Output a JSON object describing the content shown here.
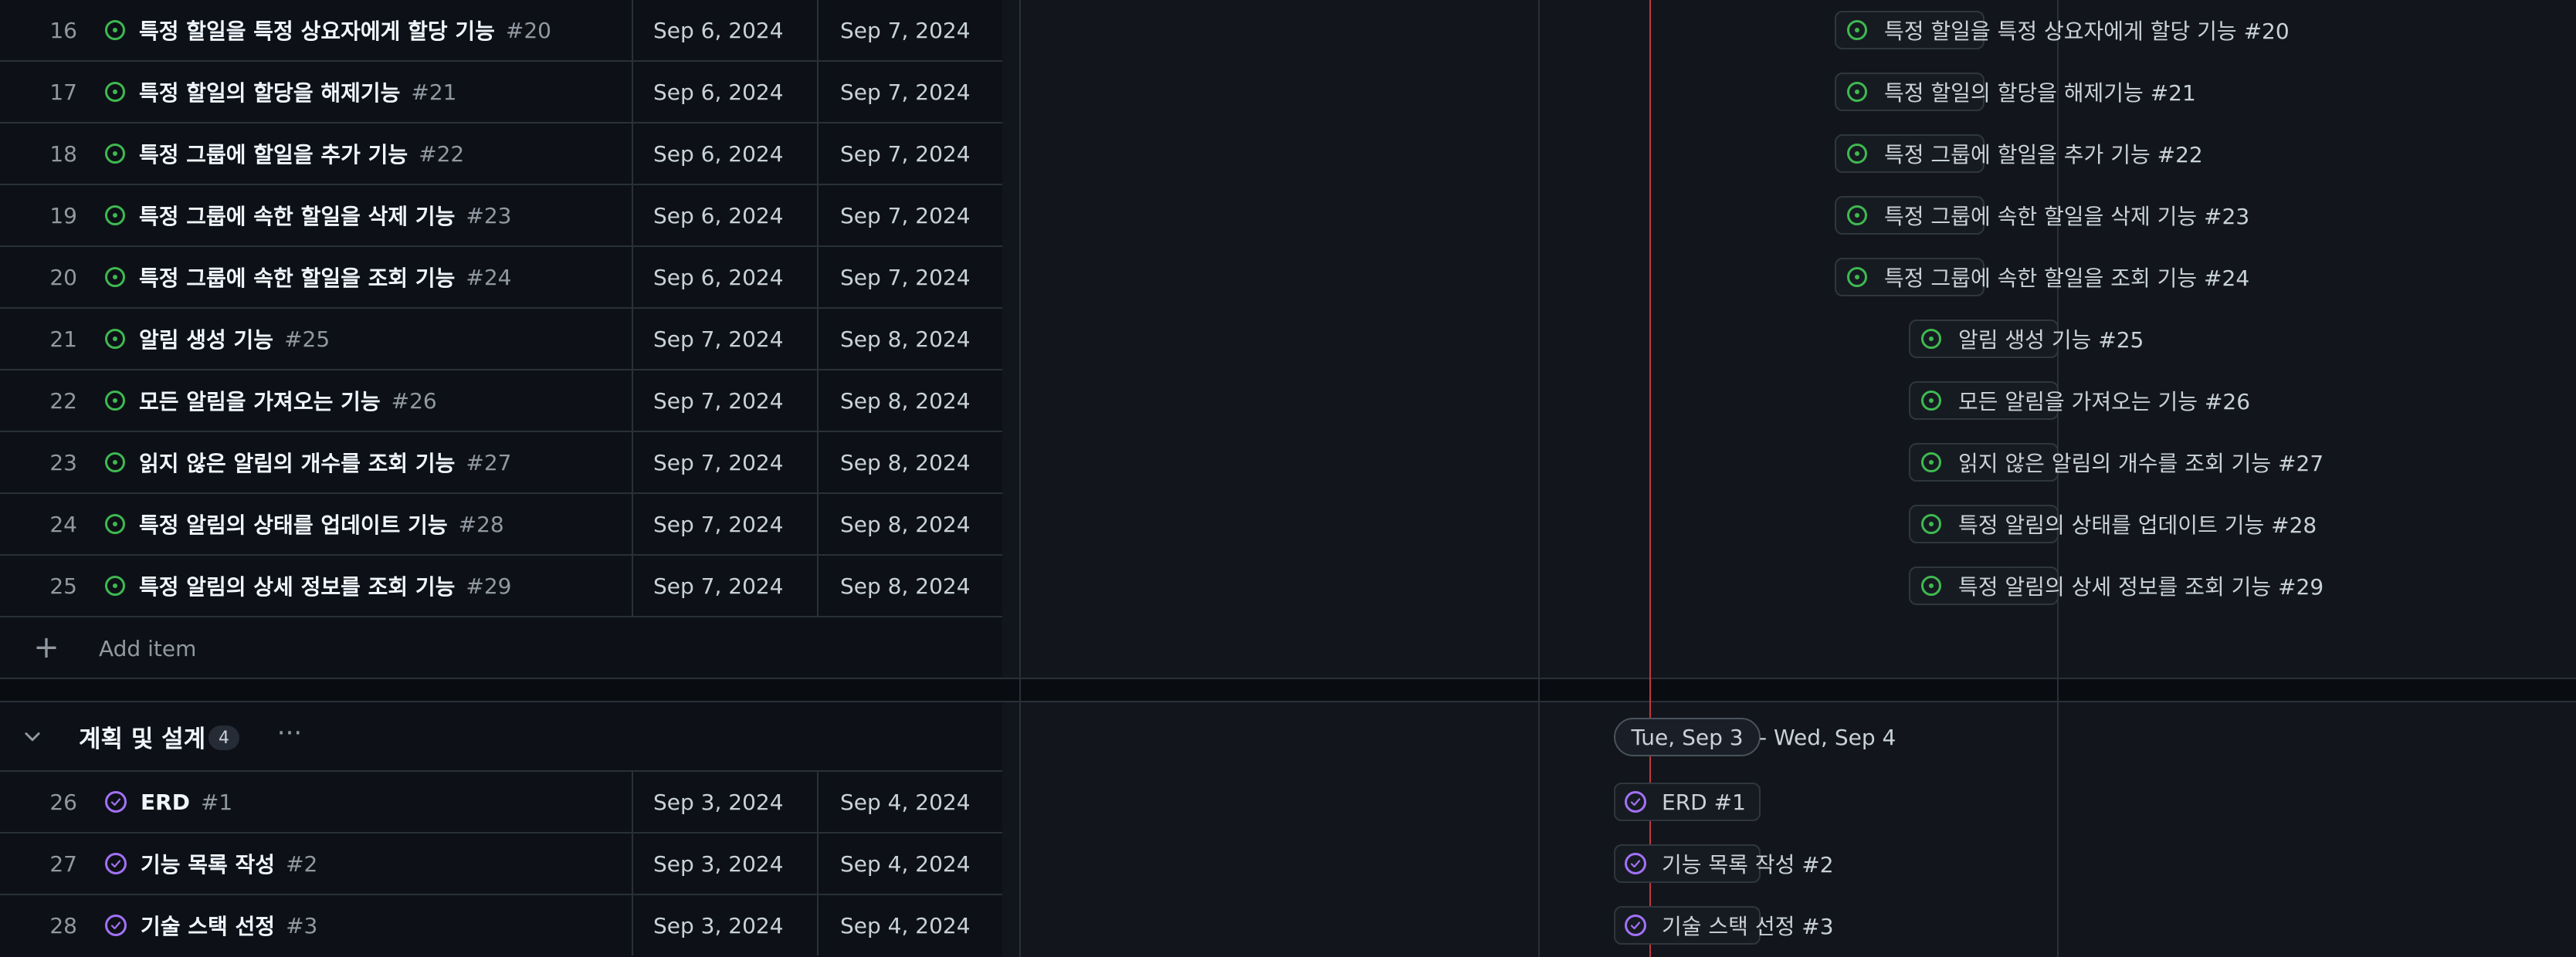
{
  "table": {
    "rows": [
      {
        "num": "16",
        "title": "특정 할일을 특정 상요자에게 할당 기능",
        "issue": "#20",
        "start": "Sep 6, 2024",
        "end": "Sep 7, 2024",
        "status": "open"
      },
      {
        "num": "17",
        "title": "특정 할일의 할당을 해제기능",
        "issue": "#21",
        "start": "Sep 6, 2024",
        "end": "Sep 7, 2024",
        "status": "open"
      },
      {
        "num": "18",
        "title": "특정 그룹에 할일을 추가 기능",
        "issue": "#22",
        "start": "Sep 6, 2024",
        "end": "Sep 7, 2024",
        "status": "open"
      },
      {
        "num": "19",
        "title": "특정 그룹에 속한 할일을 삭제 기능",
        "issue": "#23",
        "start": "Sep 6, 2024",
        "end": "Sep 7, 2024",
        "status": "open"
      },
      {
        "num": "20",
        "title": "특정 그룹에 속한 할일을 조회 기능",
        "issue": "#24",
        "start": "Sep 6, 2024",
        "end": "Sep 7, 2024",
        "status": "open"
      },
      {
        "num": "21",
        "title": "알림 생성 기능",
        "issue": "#25",
        "start": "Sep 7, 2024",
        "end": "Sep 8, 2024",
        "status": "open"
      },
      {
        "num": "22",
        "title": "모든 알림을 가져오는 기능",
        "issue": "#26",
        "start": "Sep 7, 2024",
        "end": "Sep 8, 2024",
        "status": "open"
      },
      {
        "num": "23",
        "title": "읽지 않은 알림의 개수를 조회 기능",
        "issue": "#27",
        "start": "Sep 7, 2024",
        "end": "Sep 8, 2024",
        "status": "open"
      },
      {
        "num": "24",
        "title": "특정 알림의 상태를 업데이트 기능",
        "issue": "#28",
        "start": "Sep 7, 2024",
        "end": "Sep 8, 2024",
        "status": "open"
      },
      {
        "num": "25",
        "title": "특정 알림의 상세 정보를 조회 기능",
        "issue": "#29",
        "start": "Sep 7, 2024",
        "end": "Sep 8, 2024",
        "status": "open"
      }
    ],
    "add_item_label": "Add item",
    "add_icon": "+"
  },
  "group": {
    "title": "계획 및 설계",
    "count": "4",
    "more_icon": "···",
    "rows": [
      {
        "num": "26",
        "title": "ERD",
        "issue": "#1",
        "start": "Sep 3, 2024",
        "end": "Sep 4, 2024",
        "status": "done"
      },
      {
        "num": "27",
        "title": "기능 목록 작성",
        "issue": "#2",
        "start": "Sep 3, 2024",
        "end": "Sep 4, 2024",
        "status": "done"
      },
      {
        "num": "28",
        "title": "기술 스택 선정",
        "issue": "#3",
        "start": "Sep 3, 2024",
        "end": "Sep 4, 2024",
        "status": "done"
      }
    ]
  },
  "timeline": {
    "group_range_start": "Tue, Sep 3",
    "group_range_sep_end": "- Wed, Sep 4",
    "items": [
      {
        "label": "특정 할일을 특정 상요자에게 할당 기능 #20"
      },
      {
        "label": "특정 할일의 할당을 해제기능 #21"
      },
      {
        "label": "특정 그룹에 할일을 추가 기능 #22"
      },
      {
        "label": "특정 그룹에 속한 할일을 삭제 기능 #23"
      },
      {
        "label": "특정 그룹에 속한 할일을 조회 기능 #24"
      },
      {
        "label": "알림 생성 기능 #25"
      },
      {
        "label": "모든 알림을 가져오는 기능 #26"
      },
      {
        "label": "읽지 않은 알림의 개수를 조회 기능 #27"
      },
      {
        "label": "특정 알림의 상태를 업데이트 기능 #28"
      },
      {
        "label": "특정 알림의 상세 정보를 조회 기능 #29"
      }
    ],
    "group_items": [
      {
        "label": "ERD #1"
      },
      {
        "label": "기능 목록 작성 #2"
      },
      {
        "label": "기술 스택 선정 #3"
      }
    ]
  },
  "colors": {
    "open_status": "#3fb950",
    "done_status": "#a371f7",
    "today_marker": "#c2373c"
  }
}
